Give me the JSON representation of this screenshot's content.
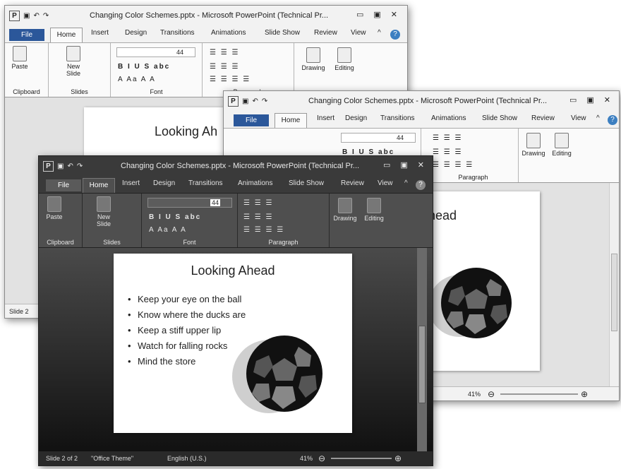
{
  "windows": {
    "back": {
      "title": "Changing Color Schemes.pptx - Microsoft PowerPoint (Technical Pr...",
      "slide_title": "Looking Ah",
      "status_left": "Slide 2"
    },
    "middle": {
      "title": "Changing Color Schemes.pptx - Microsoft PowerPoint (Technical Pr...",
      "slide_title": "head",
      "zoom": "41%"
    },
    "front": {
      "title": "Changing Color Schemes.pptx - Microsoft PowerPoint (Technical Pr...",
      "status": {
        "slide": "Slide 2 of 2",
        "theme": "\"Office Theme\"",
        "language": "English (U.S.)",
        "zoom": "41%"
      }
    }
  },
  "ribbon": {
    "tabs": [
      "File",
      "Home",
      "Insert",
      "Design",
      "Transitions",
      "Animations",
      "Slide Show",
      "Review",
      "View"
    ],
    "groups": {
      "clipboard": "Clipboard",
      "slides": "Slides",
      "font": "Font",
      "paragraph": "Paragraph"
    },
    "buttons": {
      "paste": "Paste",
      "new_slide_1": "New",
      "new_slide_2": "Slide",
      "drawing": "Drawing",
      "editing": "Editing",
      "font_size": "44"
    }
  },
  "slide": {
    "title": "Looking Ahead",
    "bullets": [
      "Keep your eye on the ball",
      "Know where the ducks are",
      "Keep a stiff upper lip",
      "Watch for falling rocks",
      "Mind the store"
    ]
  },
  "icons": {
    "app": "P",
    "save": "▣",
    "undo": "↶",
    "redo": "↷",
    "minimize": "▭",
    "maximize": "▣",
    "close": "✕",
    "help": "?",
    "collapse": "^",
    "bullets": "☰",
    "zoom_out": "⊖",
    "zoom_in": "⊕"
  },
  "colors": {
    "light_chrome": "#f2f2f2",
    "light_ribbon": "#fafafa",
    "dark_chrome": "#3a3a3a",
    "dark_ribbon": "#4f4f4f",
    "file_tab_blue": "#2b579a",
    "file_tab_dark": "#5a5a5a",
    "workspace_light": "#e2e2e2",
    "workspace_dark": "#1e1e1e",
    "ball_shadow": "#cfcfcf"
  }
}
